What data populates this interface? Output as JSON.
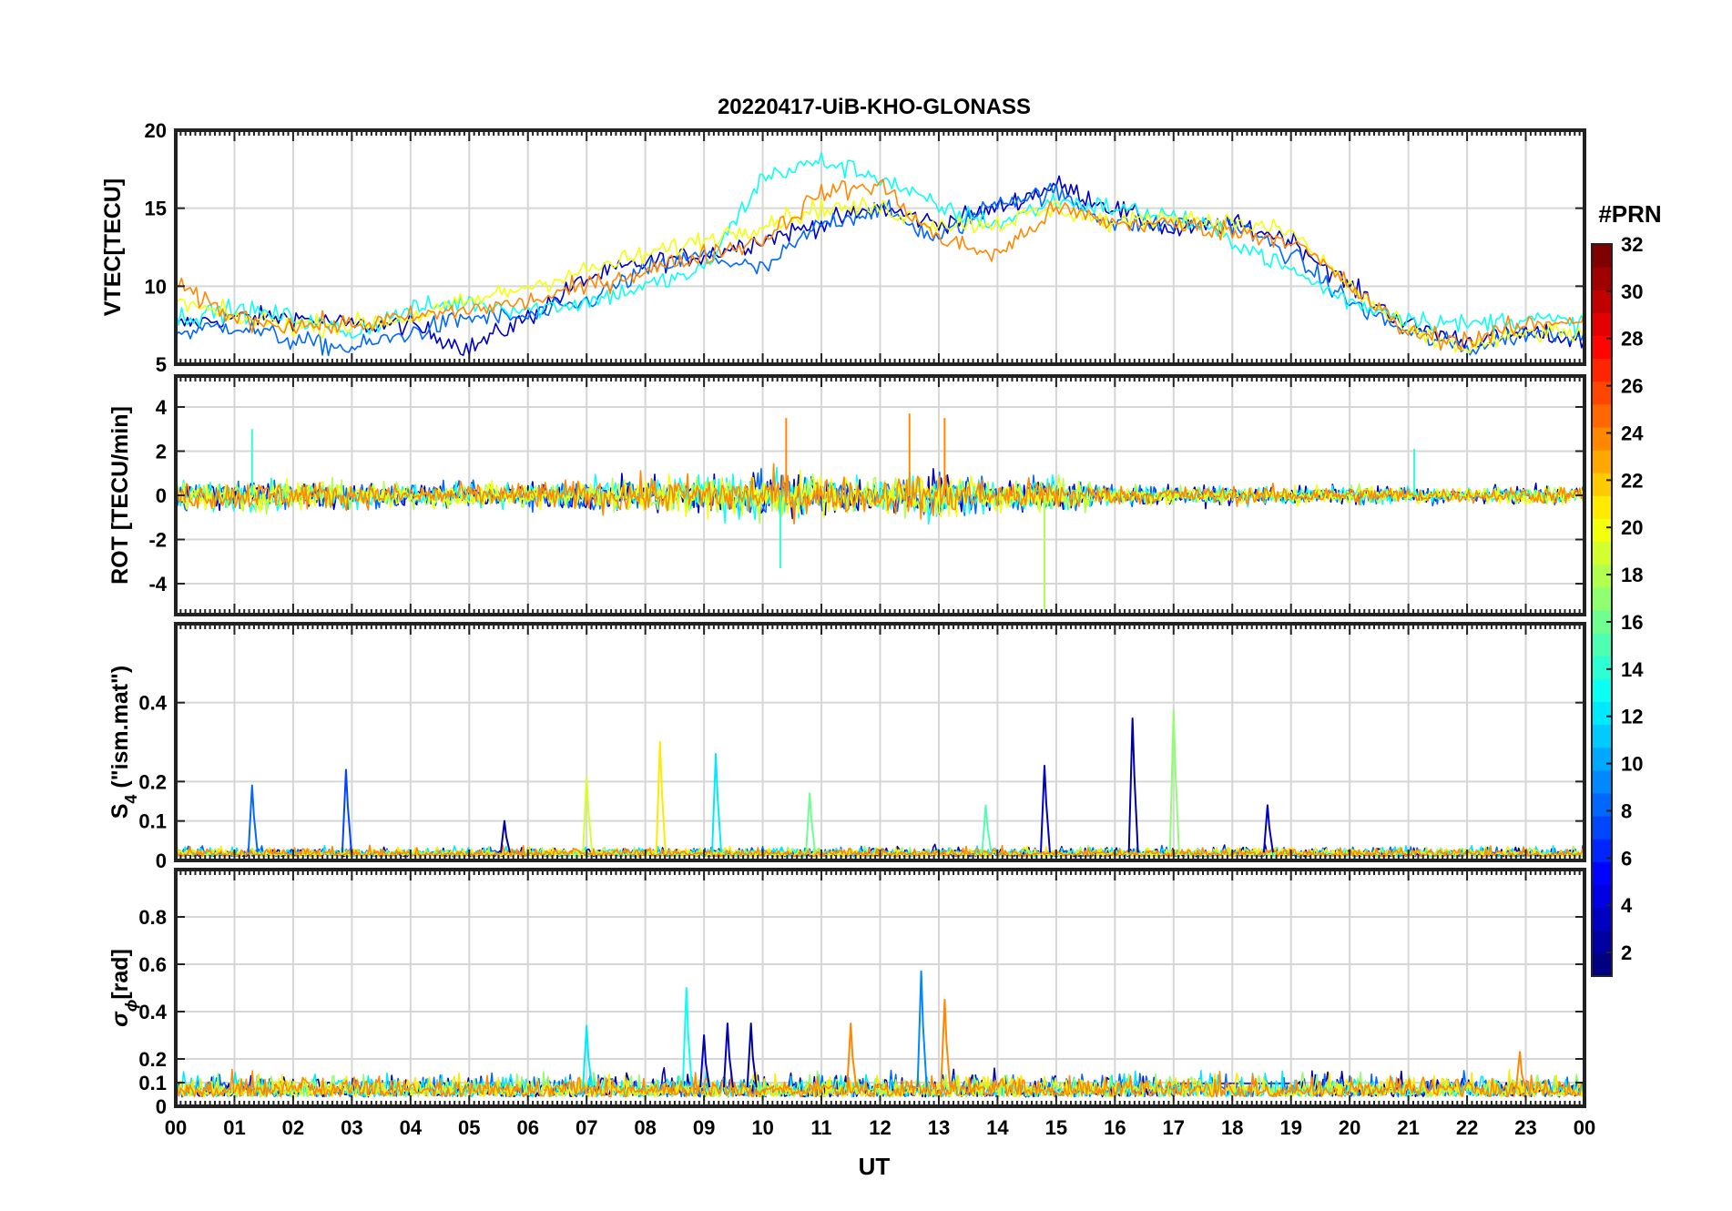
{
  "title": "20220417-UiB-KHO-GLONASS",
  "xlabel": "UT",
  "x_ticks": [
    "00",
    "01",
    "02",
    "03",
    "04",
    "05",
    "06",
    "07",
    "08",
    "09",
    "10",
    "11",
    "12",
    "13",
    "14",
    "15",
    "16",
    "17",
    "18",
    "19",
    "20",
    "21",
    "22",
    "23",
    "00"
  ],
  "colorbar": {
    "title": "#PRN",
    "ticks": [
      "2",
      "4",
      "6",
      "8",
      "10",
      "12",
      "14",
      "16",
      "18",
      "20",
      "22",
      "24",
      "26",
      "28",
      "30",
      "32"
    ],
    "range": [
      1,
      32
    ],
    "colormap": "jet",
    "levels": 32
  },
  "panels": [
    {
      "key": "vtec",
      "ylabel": "VTEC[TECU]",
      "ylim": [
        5,
        20
      ],
      "yticks": [
        "5",
        "10",
        "15",
        "20"
      ]
    },
    {
      "key": "rot",
      "ylabel": "ROT [TECU/min]",
      "ylim": [
        -5.4,
        5.4
      ],
      "yticks": [
        "-4",
        "-2",
        "0",
        "2",
        "4"
      ]
    },
    {
      "key": "s4",
      "ylabel_main": "S",
      "ylabel_sub": "4",
      "ylabel_rest": " (\"ism.mat\")",
      "ylim": [
        0,
        0.6
      ],
      "yticks": [
        "0",
        "0.1",
        "0.2",
        "0.4"
      ]
    },
    {
      "key": "sigma",
      "ylabel_main": "σ",
      "ylabel_sub": "ϕ",
      "ylabel_rest": "[rad]",
      "ylim": [
        0,
        1
      ],
      "yticks": [
        "0",
        "0.1",
        "0.2",
        "0.4",
        "0.6",
        "0.8"
      ]
    }
  ],
  "chart_data": [
    {
      "type": "line",
      "title": "20220417-UiB-KHO-GLONASS",
      "ylabel": "VTEC[TECU]",
      "xlabel": "UT",
      "xlim": [
        0,
        24
      ],
      "ylim": [
        5,
        20
      ],
      "grid": true,
      "series_color_by": "PRN (colorbar)",
      "note_values": "values estimated from gridlines; daily diurnal curve",
      "series": [
        {
          "prn": 3,
          "x": [
            0,
            1,
            2,
            3,
            4,
            5,
            6,
            7,
            8,
            9,
            10,
            11,
            12,
            13,
            14,
            15,
            16,
            17,
            18,
            19,
            20,
            21,
            22,
            23,
            24
          ],
          "values": [
            7.5,
            8,
            8,
            7.5,
            7.5,
            6,
            8,
            10.5,
            11.5,
            12,
            13,
            14,
            15,
            14,
            15,
            16.5,
            15,
            13.5,
            14,
            13,
            10,
            7.5,
            6.5,
            7,
            6.5
          ]
        },
        {
          "prn": 8,
          "x": [
            0,
            1,
            2,
            3,
            4,
            5,
            6,
            7,
            8,
            9,
            10,
            11,
            12,
            13,
            14,
            15,
            16,
            17,
            18,
            19,
            20,
            21,
            22,
            23,
            24
          ],
          "values": [
            7,
            7.5,
            6.5,
            6,
            7,
            8,
            8,
            9,
            11,
            12,
            11,
            14,
            15,
            13,
            15.5,
            16,
            14,
            14,
            14,
            12,
            9,
            7,
            6,
            7,
            7
          ]
        },
        {
          "prn": 13,
          "x": [
            0,
            1,
            2,
            3,
            4,
            5,
            6,
            7,
            8,
            9,
            10,
            11,
            12,
            13,
            14,
            15,
            16,
            17,
            18,
            19,
            20,
            21,
            22,
            23,
            24
          ],
          "values": [
            8,
            8.5,
            8,
            7,
            8.5,
            9,
            8.5,
            9,
            10,
            11,
            17,
            18,
            17,
            15,
            14,
            15.5,
            15,
            14.5,
            13,
            11,
            9,
            8,
            7.5,
            8,
            7.5
          ]
        },
        {
          "prn": 20,
          "x": [
            0,
            1,
            2,
            3,
            4,
            5,
            6,
            7,
            8,
            9,
            10,
            11,
            12,
            13,
            14,
            15,
            16,
            17,
            18,
            19,
            20,
            21,
            22,
            23,
            24
          ],
          "values": [
            9,
            8,
            7.5,
            7.5,
            8,
            9,
            10,
            11,
            12,
            13,
            14,
            15,
            15,
            14,
            14,
            15,
            14,
            14.5,
            14,
            13.5,
            10,
            7,
            6,
            7,
            7
          ]
        },
        {
          "prn": 24,
          "x": [
            0,
            1,
            2,
            3,
            4,
            5,
            6,
            7,
            8,
            9,
            10,
            11,
            12,
            13,
            14,
            15,
            16,
            17,
            18,
            19,
            20,
            21,
            22,
            23,
            24
          ],
          "values": [
            10,
            8,
            7.5,
            7.5,
            8,
            8.5,
            9,
            10,
            11,
            12,
            13,
            16,
            16.5,
            13,
            12,
            15,
            14,
            14,
            13.5,
            13,
            10,
            7,
            6.5,
            7.5,
            8
          ]
        }
      ]
    },
    {
      "type": "line",
      "ylabel": "ROT [TECU/min]",
      "xlabel": "UT",
      "xlim": [
        0,
        24
      ],
      "ylim": [
        -5.4,
        5.4
      ],
      "grid": true,
      "envelope_amplitude_by_hour": {
        "x": [
          0,
          2,
          4,
          6,
          8,
          10,
          12,
          13,
          14,
          15,
          16,
          18,
          20,
          22,
          24
        ],
        "amplitude": [
          0.8,
          0.8,
          0.6,
          0.7,
          1.0,
          1.3,
          0.9,
          1.4,
          0.8,
          1.0,
          0.5,
          0.5,
          0.5,
          0.4,
          0.5
        ]
      },
      "spikes": [
        {
          "x": 14.8,
          "y": -5.2
        },
        {
          "x": 13.1,
          "y": 3.5
        },
        {
          "x": 12.5,
          "y": 3.7
        },
        {
          "x": 10.3,
          "y": -3.3
        },
        {
          "x": 1.3,
          "y": 3.0
        },
        {
          "x": 10.4,
          "y": 3.5
        },
        {
          "x": 21.1,
          "y": 2.1
        }
      ]
    },
    {
      "type": "line",
      "ylabel": "S4 (\"ism.mat\")",
      "xlabel": "UT",
      "xlim": [
        0,
        24
      ],
      "ylim": [
        0,
        0.6
      ],
      "grid": true,
      "baseline": 0.02,
      "spikes": [
        {
          "x": 1.3,
          "y": 0.19,
          "prn": 8
        },
        {
          "x": 2.9,
          "y": 0.23,
          "prn": 7
        },
        {
          "x": 7.0,
          "y": 0.21,
          "prn": 19
        },
        {
          "x": 8.25,
          "y": 0.3,
          "prn": 21
        },
        {
          "x": 9.2,
          "y": 0.27,
          "prn": 12
        },
        {
          "x": 10.8,
          "y": 0.17,
          "prn": 16
        },
        {
          "x": 14.8,
          "y": 0.24,
          "prn": 3
        },
        {
          "x": 16.3,
          "y": 0.36,
          "prn": 2
        },
        {
          "x": 17.0,
          "y": 0.38,
          "prn": 17
        },
        {
          "x": 18.6,
          "y": 0.14,
          "prn": 3
        },
        {
          "x": 13.8,
          "y": 0.14,
          "prn": 15
        },
        {
          "x": 5.6,
          "y": 0.1,
          "prn": 2
        }
      ]
    },
    {
      "type": "line",
      "ylabel": "σϕ [rad]",
      "xlabel": "UT",
      "xlim": [
        0,
        24
      ],
      "ylim": [
        0,
        1
      ],
      "grid": true,
      "baseline": 0.08,
      "spikes": [
        {
          "x": 7.0,
          "y": 0.34,
          "prn": 12
        },
        {
          "x": 8.7,
          "y": 0.5,
          "prn": 13
        },
        {
          "x": 9.0,
          "y": 0.3,
          "prn": 3
        },
        {
          "x": 9.4,
          "y": 0.35,
          "prn": 3
        },
        {
          "x": 9.8,
          "y": 0.35,
          "prn": 2
        },
        {
          "x": 11.5,
          "y": 0.35,
          "prn": 24
        },
        {
          "x": 12.7,
          "y": 0.57,
          "prn": 9
        },
        {
          "x": 13.1,
          "y": 0.45,
          "prn": 24
        },
        {
          "x": 22.9,
          "y": 0.23,
          "prn": 24
        }
      ]
    }
  ]
}
